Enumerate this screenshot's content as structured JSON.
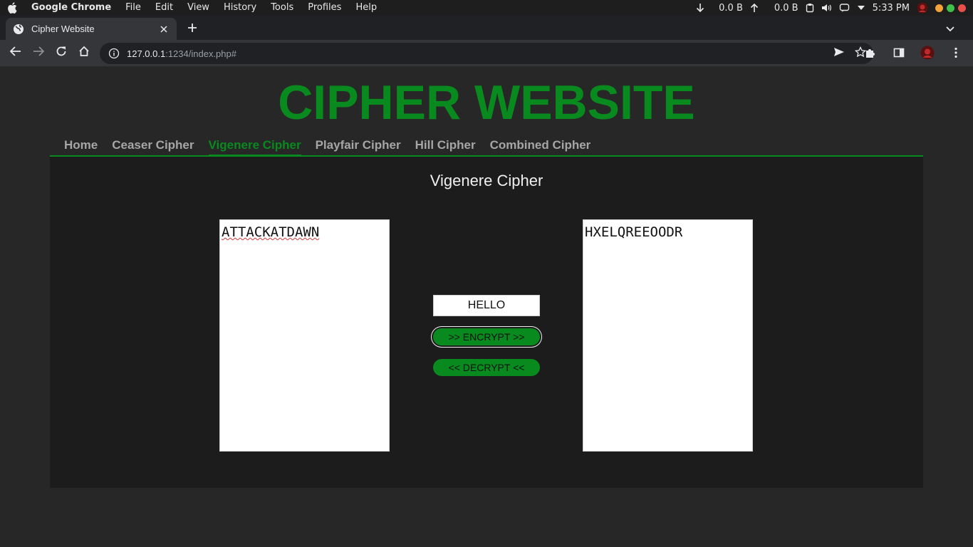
{
  "menubar": {
    "app_name": "Google Chrome",
    "items": [
      "File",
      "Edit",
      "View",
      "History",
      "Tools",
      "Profiles",
      "Help"
    ],
    "net_down": "0.0 B",
    "net_up": "0.0 B",
    "clock": "5:33 PM"
  },
  "browser": {
    "tab_title": "Cipher Website",
    "url_host": "127.0.0.1",
    "url_rest": ":1234/index.php#"
  },
  "page": {
    "site_title": "CIPHER WEBSITE",
    "nav": [
      {
        "label": "Home",
        "active": false
      },
      {
        "label": "Ceaser Cipher",
        "active": false
      },
      {
        "label": "Vigenere Cipher",
        "active": true
      },
      {
        "label": "Playfair Cipher",
        "active": false
      },
      {
        "label": "Hill Cipher",
        "active": false
      },
      {
        "label": "Combined Cipher",
        "active": false
      }
    ],
    "panel_title": "Vigenere Cipher",
    "plaintext": "ATTACKATDAWN",
    "ciphertext": "HXELQREEOODR",
    "key": "HELLO",
    "encrypt_label": ">> ENCRYPT >>",
    "decrypt_label": "<< DECRYPT <<"
  },
  "colors": {
    "accent": "#098a1f",
    "page_bg": "#272727",
    "panel_bg": "#1c1c1c"
  }
}
